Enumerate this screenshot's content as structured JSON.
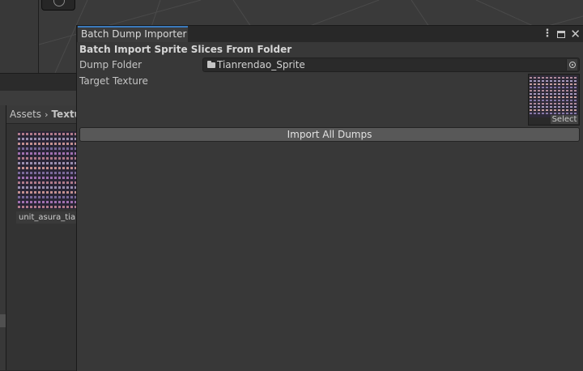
{
  "project": {
    "breadcrumb": [
      "Assets",
      "Textures"
    ],
    "breadcrumb_separator": "›",
    "asset_label": "unit_asura_tianrendao"
  },
  "window": {
    "tab_title": "Batch Dump Importer",
    "controls": {
      "menu": "⋮",
      "close": "✕"
    },
    "section_header": "Batch Import Sprite Slices From Folder",
    "dump_folder_label": "Dump Folder",
    "dump_folder_value": "Tianrendao_Sprite",
    "target_texture_label": "Target Texture",
    "texture_select_label": "Select",
    "import_button_label": "Import All Dumps"
  },
  "colors": {
    "accent": "#3a79bb",
    "window_bg": "#383838",
    "button_bg": "#585858"
  }
}
